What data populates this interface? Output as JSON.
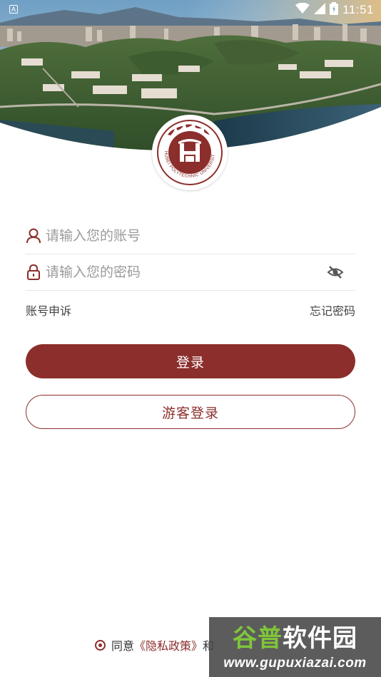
{
  "status_bar": {
    "indicator": "A",
    "time": "11:51",
    "icons": [
      "wifi-icon",
      "signal-icon",
      "battery-icon"
    ]
  },
  "hero": {
    "image": "campus-aerial-photo"
  },
  "logo": {
    "name": "university-seal",
    "outer_text": "HUBEI POLYTECHNIC UNIVERSITY",
    "calligraphy": "湖北理工学院"
  },
  "form": {
    "account": {
      "placeholder": "请输入您的账号",
      "value": "",
      "icon": "user-icon"
    },
    "password": {
      "placeholder": "请输入您的密码",
      "value": "",
      "icon": "lock-icon",
      "toggle_icon": "eye-hidden-icon"
    }
  },
  "links": {
    "appeal": "账号申诉",
    "forgot": "忘记密码"
  },
  "buttons": {
    "login": "登录",
    "guest": "游客登录"
  },
  "agreement": {
    "checked": true,
    "prefix": "同意",
    "policy": "《隐私政策》",
    "suffix": "和"
  },
  "watermark": {
    "logo_part1": "谷普",
    "logo_part2": "软件园",
    "url": "www.gupuxiazai.com"
  },
  "colors": {
    "brand": "#8b2e2c",
    "placeholder": "#9a9a9a",
    "divider": "#e6e6e6"
  }
}
